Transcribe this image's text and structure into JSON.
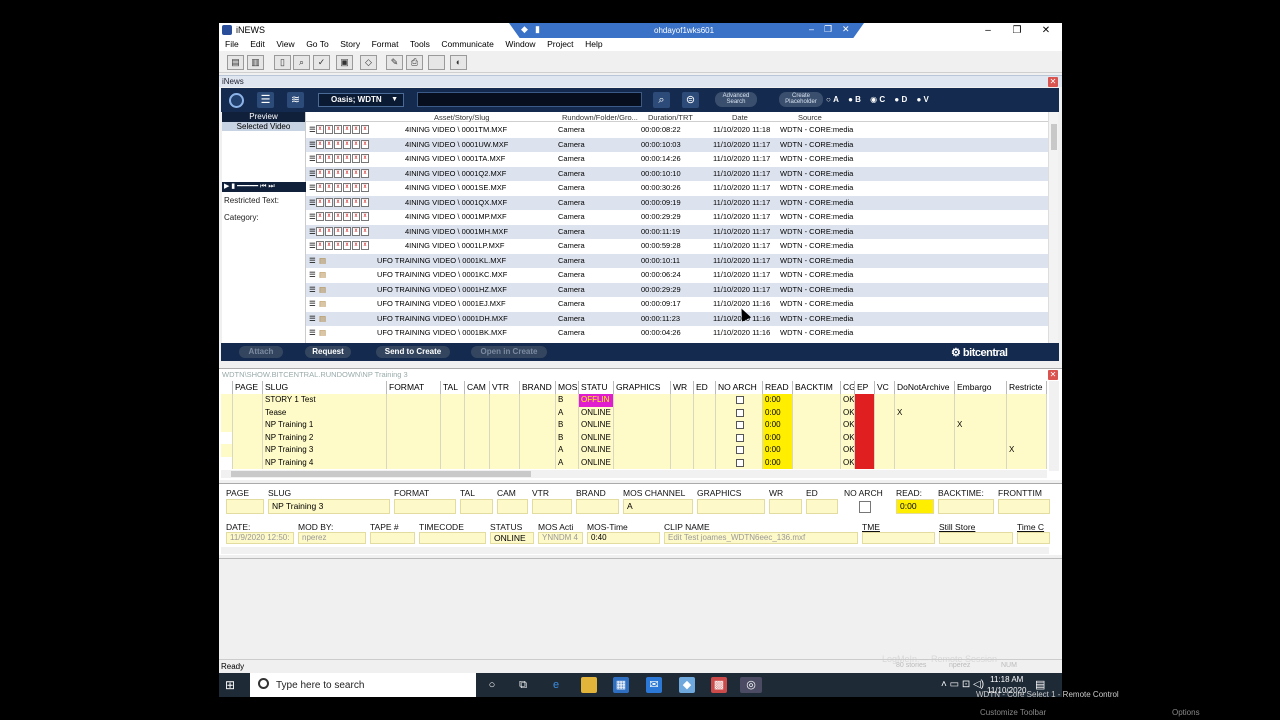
{
  "window": {
    "title": "iNEWS",
    "remote_title": "ohdayof1wks601",
    "min_label": "–",
    "max_label": "❐",
    "close_label": "✕"
  },
  "menu": [
    "File",
    "Edit",
    "View",
    "Go To",
    "Story",
    "Format",
    "Tools",
    "Communicate",
    "Window",
    "Project",
    "Help"
  ],
  "subwindow_title": "iNews",
  "search_bar": {
    "server_label": "Oasis; WDTN",
    "advanced_search": "Advanced Search",
    "create_placeholder": "Create Placeholder",
    "radios": [
      "A",
      "B",
      "C",
      "D",
      "V"
    ]
  },
  "preview": {
    "header": "Preview",
    "selected_video": "Selected Video",
    "restricted_text": "Restricted Text:",
    "category": "Category:"
  },
  "asset_columns": [
    "Asset/Story/Slug",
    "Rundown/Folder/Gro...",
    "Duration/TRT",
    "Date",
    "Source"
  ],
  "assets": [
    {
      "slug": "4INING VIDEO \\ 0001TM.MXF",
      "folder": "Camera",
      "duration": "00:00:08:22",
      "date": "11/10/2020 11:18",
      "source": "WDTN - CORE:media",
      "boxes": true
    },
    {
      "slug": "4INING VIDEO \\ 0001UW.MXF",
      "folder": "Camera",
      "duration": "00:00:10:03",
      "date": "11/10/2020 11:17",
      "source": "WDTN - CORE:media",
      "boxes": true
    },
    {
      "slug": "4INING VIDEO \\ 0001TA.MXF",
      "folder": "Camera",
      "duration": "00:00:14:26",
      "date": "11/10/2020 11:17",
      "source": "WDTN - CORE:media",
      "boxes": true
    },
    {
      "slug": "4INING VIDEO \\ 0001Q2.MXF",
      "folder": "Camera",
      "duration": "00:00:10:10",
      "date": "11/10/2020 11:17",
      "source": "WDTN - CORE:media",
      "boxes": true
    },
    {
      "slug": "4INING VIDEO \\ 0001SE.MXF",
      "folder": "Camera",
      "duration": "00:00:30:26",
      "date": "11/10/2020 11:17",
      "source": "WDTN - CORE:media",
      "boxes": true
    },
    {
      "slug": "4INING VIDEO \\ 0001QX.MXF",
      "folder": "Camera",
      "duration": "00:00:09:19",
      "date": "11/10/2020 11:17",
      "source": "WDTN - CORE:media",
      "boxes": true
    },
    {
      "slug": "4INING VIDEO \\ 0001MP.MXF",
      "folder": "Camera",
      "duration": "00:00:29:29",
      "date": "11/10/2020 11:17",
      "source": "WDTN - CORE:media",
      "boxes": true
    },
    {
      "slug": "4INING VIDEO \\ 0001MH.MXF",
      "folder": "Camera",
      "duration": "00:00:11:19",
      "date": "11/10/2020 11:17",
      "source": "WDTN - CORE:media",
      "boxes": true
    },
    {
      "slug": "4INING VIDEO \\ 0001LP.MXF",
      "folder": "Camera",
      "duration": "00:00:59:28",
      "date": "11/10/2020 11:17",
      "source": "WDTN - CORE:media",
      "boxes": true
    },
    {
      "slug": "UFO TRAINING VIDEO \\ 0001KL.MXF",
      "folder": "Camera",
      "duration": "00:00:10:11",
      "date": "11/10/2020 11:17",
      "source": "WDTN - CORE:media",
      "boxes": false
    },
    {
      "slug": "UFO TRAINING VIDEO \\ 0001KC.MXF",
      "folder": "Camera",
      "duration": "00:00:06:24",
      "date": "11/10/2020 11:17",
      "source": "WDTN - CORE:media",
      "boxes": false
    },
    {
      "slug": "UFO TRAINING VIDEO \\ 0001HZ.MXF",
      "folder": "Camera",
      "duration": "00:00:29:29",
      "date": "11/10/2020 11:17",
      "source": "WDTN - CORE:media",
      "boxes": false
    },
    {
      "slug": "UFO TRAINING VIDEO \\ 0001EJ.MXF",
      "folder": "Camera",
      "duration": "00:00:09:17",
      "date": "11/10/2020 11:16",
      "source": "WDTN - CORE:media",
      "boxes": false
    },
    {
      "slug": "UFO TRAINING VIDEO \\ 0001DH.MXF",
      "folder": "Camera",
      "duration": "00:00:11:23",
      "date": "11/10/2020 11:16",
      "source": "WDTN - CORE:media",
      "boxes": false
    },
    {
      "slug": "UFO TRAINING VIDEO \\ 0001BK.MXF",
      "folder": "Camera",
      "duration": "00:00:04:26",
      "date": "11/10/2020 11:16",
      "source": "WDTN - CORE:media",
      "boxes": false
    }
  ],
  "asset_buttons": {
    "attach": "Attach",
    "request": "Request",
    "send": "Send to Create",
    "open": "Open in Create"
  },
  "brand": "bitcentral",
  "rundown": {
    "title": "WDTN\\SHOW.BITCENTRAL.RUNDOWN\\NP Training 3",
    "columns": [
      "PAGE",
      "SLUG",
      "FORMAT",
      "TAL",
      "CAM",
      "VTR",
      "BRAND",
      "MOS",
      "STATU",
      "GRAPHICS",
      "WR",
      "ED",
      "NO ARCH",
      "READ",
      "BACKTIM",
      "CG",
      "EP",
      "VC",
      "DoNotArchive",
      "Embargo",
      "Restricte"
    ],
    "rows": [
      {
        "slug": "STORY 1 Test",
        "mos": "B",
        "status": "OFFLIN",
        "read": "0:00",
        "cg": "OK",
        "dna": "",
        "embargo": "",
        "restrict": "",
        "yellow": true
      },
      {
        "slug": "Tease",
        "mos": "A",
        "status": "ONLINE",
        "read": "0:00",
        "cg": "OK",
        "dna": "X",
        "embargo": "",
        "restrict": "",
        "yellow": true
      },
      {
        "slug": "NP Training 1",
        "mos": "B",
        "status": "ONLINE",
        "read": "0:00",
        "cg": "OK",
        "dna": "",
        "embargo": "X",
        "restrict": "",
        "yellow": true
      },
      {
        "slug": "NP Training 2",
        "mos": "B",
        "status": "ONLINE",
        "read": "0:00",
        "cg": "OK",
        "dna": "",
        "embargo": "",
        "restrict": "",
        "yellow": false
      },
      {
        "slug": "NP Training 3",
        "mos": "A",
        "status": "ONLINE",
        "read": "0:00",
        "cg": "OK",
        "dna": "",
        "embargo": "",
        "restrict": "X",
        "yellow": true
      },
      {
        "slug": "NP Training 4",
        "mos": "A",
        "status": "ONLINE",
        "read": "0:00",
        "cg": "OK",
        "dna": "",
        "embargo": "",
        "restrict": "",
        "yellow": false
      }
    ]
  },
  "form": {
    "l1": [
      "PAGE",
      "SLUG",
      "FORMAT",
      "TAL",
      "CAM",
      "VTR",
      "BRAND",
      "MOS CHANNEL",
      "GRAPHICS",
      "WR",
      "ED",
      "NO ARCH",
      "READ:",
      "BACKTIME:",
      "FRONTTIM"
    ],
    "slug_value": "NP Training 3",
    "mos_value": "A",
    "read_value": "0:00",
    "l2": [
      "DATE:",
      "MOD BY:",
      "TAPE #",
      "TIMECODE",
      "STATUS",
      "MOS Acti",
      "MOS-Time",
      "CLIP NAME",
      "TME",
      "Still Store",
      "Time C"
    ],
    "date_value": "11/9/2020 12:50:",
    "mod_value": "nperez",
    "status_value": "ONLINE",
    "mosact_value": "YNNDM 4",
    "mostime_value": "0:40",
    "clip_value": "Edit Test joames_WDTN6eec_136.mxf"
  },
  "status": {
    "ready": "Ready",
    "stories": "80 stories",
    "user": "nperez",
    "num": "NUM"
  },
  "taskbar": {
    "search": "Type here to search",
    "time": "11:18 AM",
    "date": "11/10/2020"
  },
  "overlay": {
    "remote_control": "WDTN - Core Select 1 - Remote Control",
    "customize": "Customize Toolbar",
    "options": "Options",
    "logmein": "LogMeIn — Remote Session"
  }
}
